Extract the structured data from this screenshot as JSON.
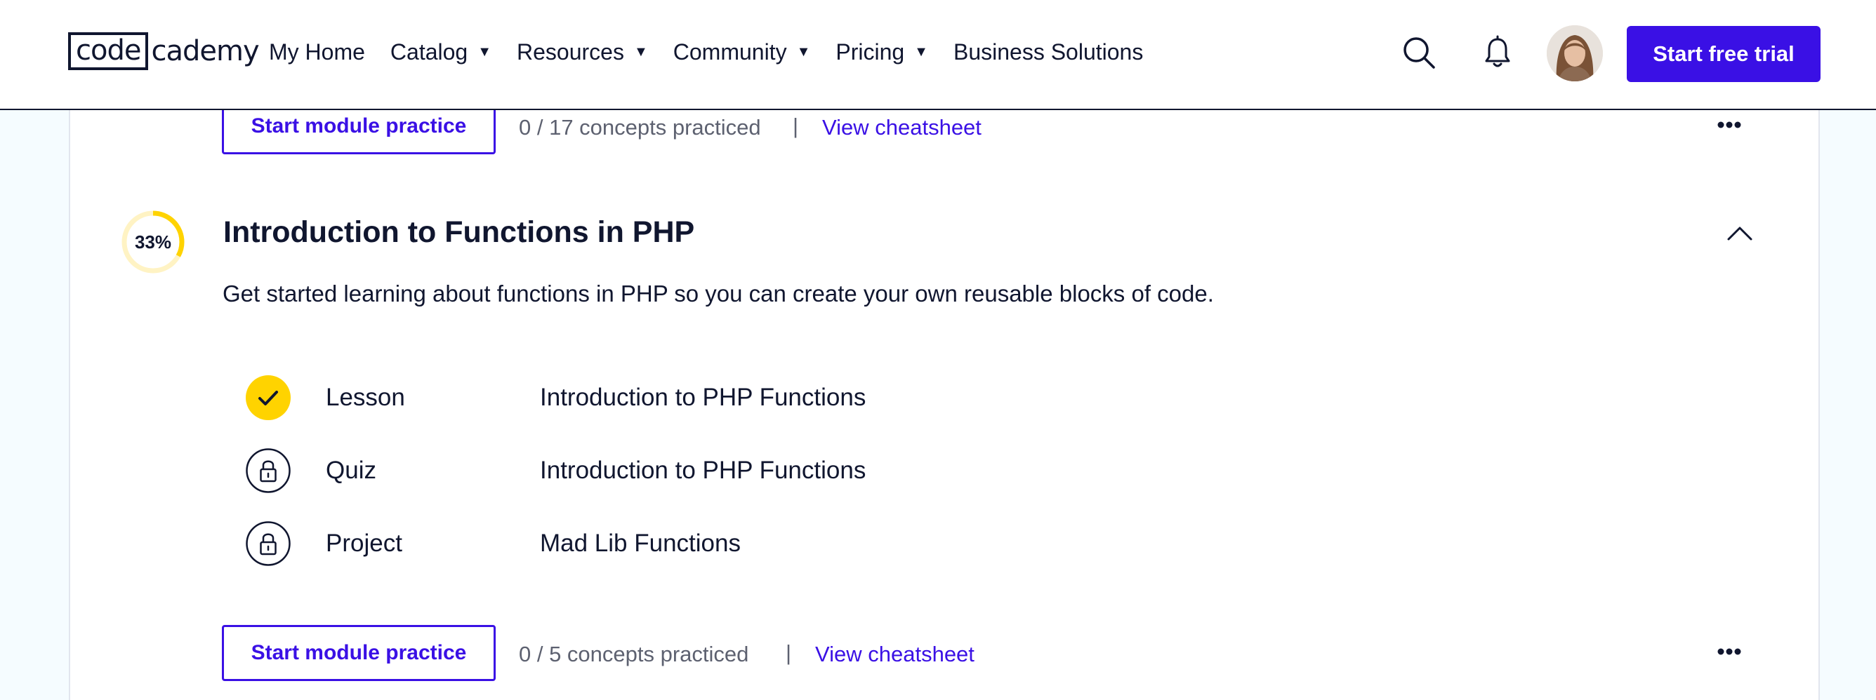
{
  "header": {
    "logo": {
      "box": "code",
      "rest": "cademy"
    },
    "nav": [
      {
        "label": "My Home",
        "dropdown": false
      },
      {
        "label": "Catalog",
        "dropdown": true
      },
      {
        "label": "Resources",
        "dropdown": true
      },
      {
        "label": "Community",
        "dropdown": true
      },
      {
        "label": "Pricing",
        "dropdown": true
      },
      {
        "label": "Business Solutions",
        "dropdown": false
      }
    ],
    "caret": "▼",
    "icons": [
      "search-icon",
      "bell-icon"
    ],
    "cta": "Start free trial"
  },
  "previous_module": {
    "practice_button": "Start module practice",
    "concepts": "0 / 17 concepts practiced",
    "separator": "|",
    "cheatsheet": "View cheatsheet"
  },
  "module": {
    "progress_percent": 33,
    "progress_label": "33%",
    "title": "Introduction to Functions in PHP",
    "description": "Get started learning about functions in PHP so you can create your own reusable blocks of code.",
    "items": [
      {
        "type": "Lesson",
        "name": "Introduction to PHP Functions",
        "status": "completed",
        "icon": "check-icon"
      },
      {
        "type": "Quiz",
        "name": "Introduction to PHP Functions",
        "status": "locked",
        "icon": "lock-icon"
      },
      {
        "type": "Project",
        "name": "Mad Lib Functions",
        "status": "locked",
        "icon": "lock-icon"
      }
    ],
    "practice_button": "Start module practice",
    "concepts": "0 / 5 concepts practiced",
    "separator": "|",
    "cheatsheet": "View cheatsheet"
  },
  "colors": {
    "brand": "#3a10e5",
    "navy": "#10162f",
    "progress": "#ffd300",
    "progress_track": "#fff3c4",
    "background": "#f5fcff"
  }
}
